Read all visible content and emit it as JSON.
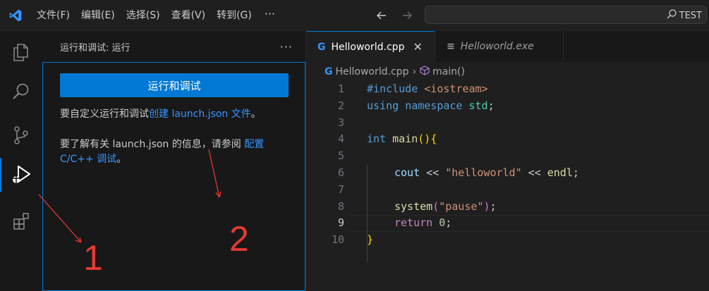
{
  "menu": [
    "文件(F)",
    "编辑(E)",
    "选择(S)",
    "查看(V)",
    "转到(G)"
  ],
  "menu_more": "···",
  "search": {
    "text": "TEST"
  },
  "sidebar": {
    "title": "运行和调试: 运行",
    "more": "···",
    "run_button": "运行和调试",
    "para1_prefix": "要自定义运行和调试",
    "para1_link": "创建 launch.json 文件",
    "para1_suffix": "。",
    "para2_prefix": "要了解有关 launch.json 的信息，请参阅 ",
    "para2_link": "配置 C/C++ 调试",
    "para2_suffix": "。"
  },
  "tabs": [
    {
      "label": "Helloworld.cpp",
      "close": "✕"
    },
    {
      "label": "Helloworld.exe"
    }
  ],
  "breadcrumb": {
    "file": "Helloworld.cpp",
    "symbol": "main()"
  },
  "code_lines": [
    {
      "n": "1"
    },
    {
      "n": "2"
    },
    {
      "n": "3"
    },
    {
      "n": "4"
    },
    {
      "n": "5"
    },
    {
      "n": "6"
    },
    {
      "n": "7"
    },
    {
      "n": "8"
    },
    {
      "n": "9"
    },
    {
      "n": "10"
    }
  ],
  "code": {
    "l1_kw": "#include",
    "l1_rest": " <iostream>",
    "l2_kw1": "using",
    "l2_kw2": "namespace",
    "l2_ns": "std",
    "l2_semi": ";",
    "l4_type": "int",
    "l4_fn": "main",
    "l4_p": "()",
    "l4_b": "{",
    "l6_a": "cout",
    "l6_op1": " << ",
    "l6_str": "\"helloworld\"",
    "l6_op2": " << ",
    "l6_b": "endl",
    "l6_semi": ";",
    "l8_fn": "system",
    "l8_p1": "(",
    "l8_str": "\"pause\"",
    "l8_p2": ")",
    "l8_semi": ";",
    "l9_kw": "return",
    "l9_num": "0",
    "l9_semi": ";",
    "l10_b": "}"
  },
  "annotations": {
    "one": "1",
    "two": "2"
  },
  "colors": {
    "accent": "#0078d4",
    "link": "#3794ff",
    "keyword": "#569cd6",
    "preproc": "#c586c0",
    "string": "#ce9178",
    "function": "#dcdcaa",
    "variable": "#9cdcfe",
    "type": "#4ec9b0",
    "number": "#b5cea8",
    "bracket": "#ffd700",
    "annotation": "#e53935"
  }
}
